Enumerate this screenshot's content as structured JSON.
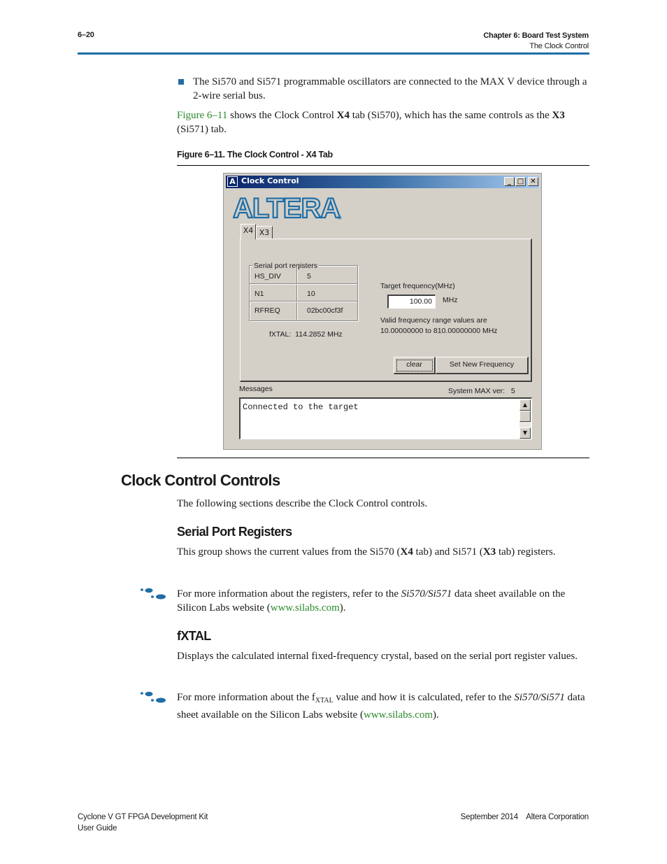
{
  "header": {
    "page_number": "6–20",
    "chapter": "Chapter 6:  Board Test System",
    "section": "The Clock Control",
    "rule_color": "#1f6ea6"
  },
  "intro": {
    "bullet": "The Si570 and Si571 programmable oscillators are connected to the MAX V device through a 2-wire serial bus.",
    "figref_link": "Figure 6–11",
    "figref_text_1": " shows the Clock Control ",
    "figref_bold_1": "X4",
    "figref_text_2": " tab (Si570), which has the same controls as the ",
    "figref_bold_2": "X3",
    "figref_text_3": " (Si571) tab."
  },
  "figure": {
    "caption": "Figure 6–11.  The Clock Control - X4 Tab",
    "window": {
      "title": "Clock Control",
      "app_icon": "A",
      "minimize": "_",
      "maximize": "□",
      "close": "✕",
      "logo_text": "ALTERA",
      "logo_registered": "®",
      "logo_color": "#1f6ea6",
      "tabs": [
        {
          "label": "X4",
          "active": true
        },
        {
          "label": "X3",
          "active": false
        }
      ],
      "registers": {
        "group_label": "Serial port registers",
        "rows": [
          {
            "name": "HS_DIV",
            "value": "5"
          },
          {
            "name": "N1",
            "value": "10"
          },
          {
            "name": "RFREQ",
            "value": "02bc00cf3f"
          }
        ]
      },
      "fxtal_label": "fXTAL:",
      "fxtal_value": "114.2852 MHz",
      "target_label": "Target frequency(MHz)",
      "target_value": "100.00",
      "target_unit": "MHz",
      "valid_line1": "Valid frequency range values are",
      "valid_line2": "10.00000000 to 810.00000000 MHz",
      "clear_button": "clear",
      "set_button": "Set New Frequency",
      "messages_label": "Messages",
      "max_ver_label": "System MAX ver:",
      "max_ver_value": "5",
      "message_text": "Connected to the target"
    }
  },
  "sections": {
    "h1": "Clock Control Controls",
    "h1_desc": "The following sections describe the Clock Control controls.",
    "spr_title": "Serial Port Registers",
    "spr_text_1": "This group shows the current values from the Si570 (",
    "spr_bold_1": "X4",
    "spr_text_2": " tab) and Si571 (",
    "spr_bold_2": "X3",
    "spr_text_3": " tab) registers.",
    "note1_text_1": "For more information about the registers, refer to the ",
    "note1_italic": "Si570/Si571",
    "note1_text_2": " data sheet available on the Silicon Labs website (",
    "note1_link": "www.silabs.com",
    "note1_text_3": ").",
    "fxtal_title": "fXTAL",
    "fxtal_desc": "Displays the calculated internal fixed-frequency crystal, based on the serial port register values.",
    "note2_text_1": "For more information about the f",
    "note2_sub": "XTAL",
    "note2_text_2": " value and how it is calculated, refer to the ",
    "note2_italic": "Si570/Si571",
    "note2_text_3": " data sheet available on the Silicon Labs website (",
    "note2_link": "www.silabs.com",
    "note2_text_4": ")."
  },
  "footer": {
    "left_line1": "Cyclone V GT FPGA Development Kit",
    "left_line2": "User Guide",
    "date": "September 2014",
    "company": "Altera Corporation"
  }
}
